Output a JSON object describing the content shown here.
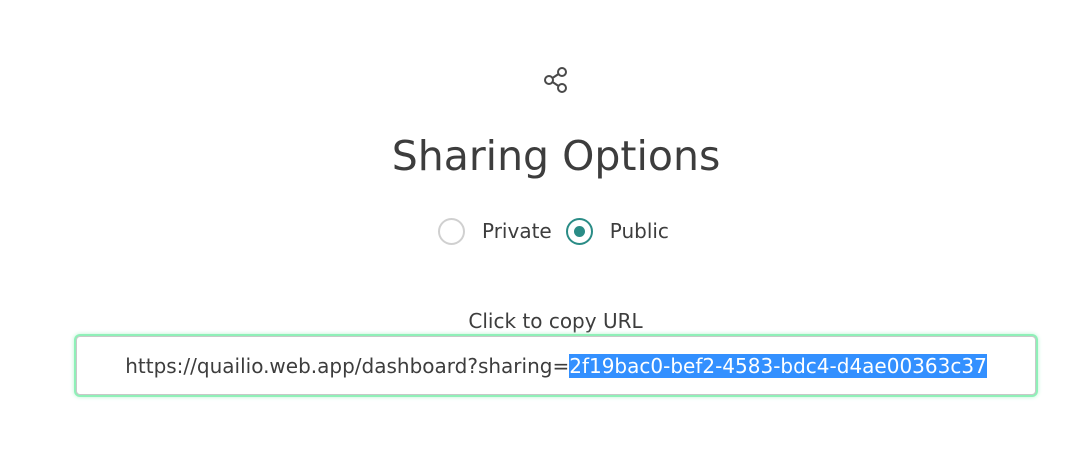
{
  "dialog": {
    "icon": "share-icon",
    "title": "Sharing Options",
    "visibility": {
      "options": [
        {
          "label": "Private",
          "checked": false
        },
        {
          "label": "Public",
          "checked": true
        }
      ]
    },
    "copy_label": "Click to copy URL",
    "url": {
      "prefix": "https://quailio.web.app/dashboard?sharing=",
      "token": "2f19bac0-bef2-4583-bdc4-d4ae00363c37"
    },
    "colors": {
      "accent": "#2a8c86",
      "selection": "#3390ff",
      "focus_glow": "#8ff0b8",
      "text": "#3d3d3d"
    }
  }
}
